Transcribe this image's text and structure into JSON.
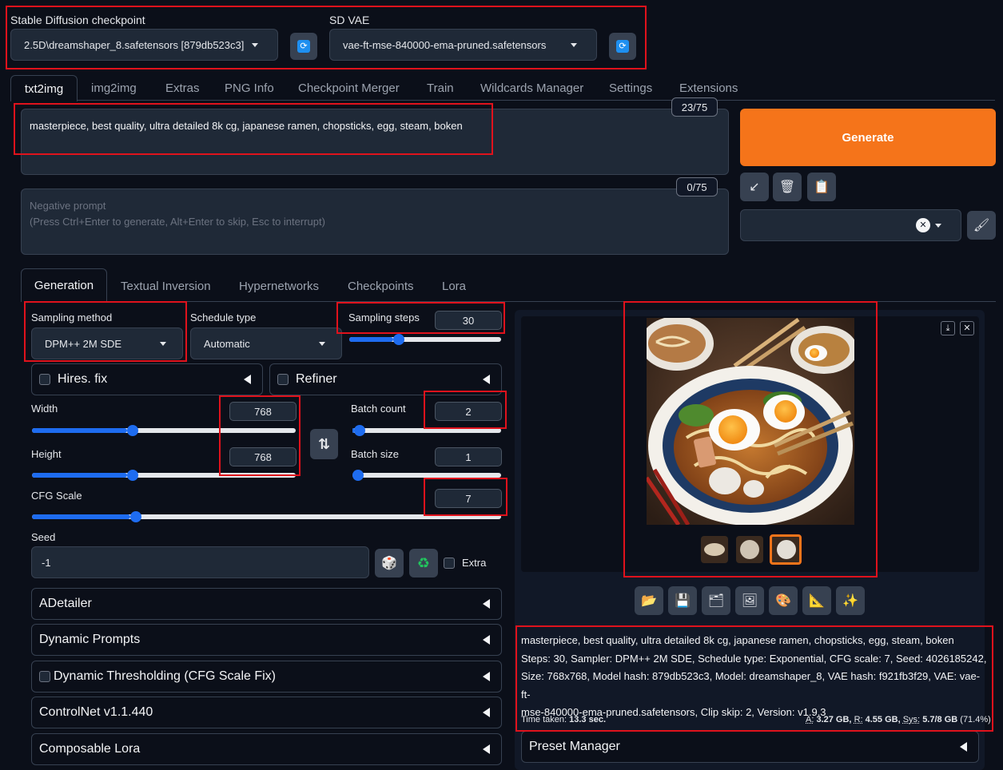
{
  "top": {
    "checkpoint_label": "Stable Diffusion checkpoint",
    "checkpoint_value": "2.5D\\dreamshaper_8.safetensors [879db523c3]",
    "vae_label": "SD VAE",
    "vae_value": "vae-ft-mse-840000-ema-pruned.safetensors"
  },
  "tabs": [
    "txt2img",
    "img2img",
    "Extras",
    "PNG Info",
    "Checkpoint Merger",
    "Train",
    "Wildcards Manager",
    "Settings",
    "Extensions"
  ],
  "prompt": {
    "text": "masterpiece, best quality, ultra detailed 8k cg, japanese ramen, chopsticks, egg, steam, boken",
    "counter": "23/75",
    "negative_counter": "0/75",
    "negative_placeholder_1": "Negative prompt",
    "negative_placeholder_2": "(Press Ctrl+Enter to generate, Alt+Enter to skip, Esc to interrupt)"
  },
  "actions": {
    "generate_label": "Generate",
    "arrow_icon": "↙",
    "trash_icon": "🗑",
    "clipboard_icon": "📋",
    "clear_icon": "✕",
    "brush_icon": "🖌"
  },
  "subtabs": [
    "Generation",
    "Textual Inversion",
    "Hypernetworks",
    "Checkpoints",
    "Lora"
  ],
  "sampling": {
    "method_label": "Sampling method",
    "method_value": "DPM++ 2M SDE",
    "schedule_label": "Schedule type",
    "schedule_value": "Automatic",
    "steps_label": "Sampling steps",
    "steps_value": "30",
    "steps_fraction": 0.29
  },
  "hires_label": "Hires. fix",
  "refiner_label": "Refiner",
  "dimensions": {
    "width_label": "Width",
    "width_value": "768",
    "width_fraction": 0.36,
    "height_label": "Height",
    "height_value": "768",
    "height_fraction": 0.36,
    "swap_icon": "⇅",
    "batch_count_label": "Batch count",
    "batch_count_value": "2",
    "batch_count_fraction": 0.01,
    "batch_size_label": "Batch size",
    "batch_size_value": "1",
    "batch_size_fraction": 0.0
  },
  "cfg": {
    "label": "CFG Scale",
    "value": "7",
    "fraction": 0.21
  },
  "seed": {
    "label": "Seed",
    "value": "-1",
    "dice_icon": "🎲",
    "recycle_icon": "♻",
    "extra_label": "Extra"
  },
  "accordions": [
    "ADetailer",
    "Dynamic Prompts",
    "Dynamic Thresholding (CFG Scale Fix)",
    "ControlNet v1.1.440",
    "Composable Lora"
  ],
  "output": {
    "download_icon": "⤓",
    "close_icon": "✕",
    "toolbar_icons": [
      "📂",
      "💾",
      "🗂",
      "🖼",
      "🎨",
      "📐",
      "✨"
    ],
    "info_line1": "masterpiece, best quality, ultra detailed 8k cg, japanese ramen, chopsticks, egg, steam, boken",
    "info_line2": "Steps: 30, Sampler: DPM++ 2M SDE, Schedule type: Exponential, CFG scale: 7, Seed: 4026185242,",
    "info_line3": "Size: 768x768, Model hash: 879db523c3, Model: dreamshaper_8, VAE hash: f921fb3f29, VAE: vae-ft-",
    "info_line4": "mse-840000-ema-pruned.safetensors, Clip skip: 2, Version: v1.9.3",
    "time_label": "Time taken:",
    "time_value": "13.3 sec.",
    "mem_a_label": "A:",
    "mem_a_value": "3.27 GB,",
    "mem_r_label": "R:",
    "mem_r_value": "4.55 GB,",
    "mem_sys_label": "Sys:",
    "mem_sys_value": "5.7/8 GB",
    "mem_pct": "(71.4%)"
  },
  "preset_manager_label": "Preset Manager",
  "colors": {
    "accent_orange": "#f5741a",
    "slider_blue": "#1e6cf0",
    "annotation_red": "#e0121c",
    "background": "#0b0f19"
  }
}
